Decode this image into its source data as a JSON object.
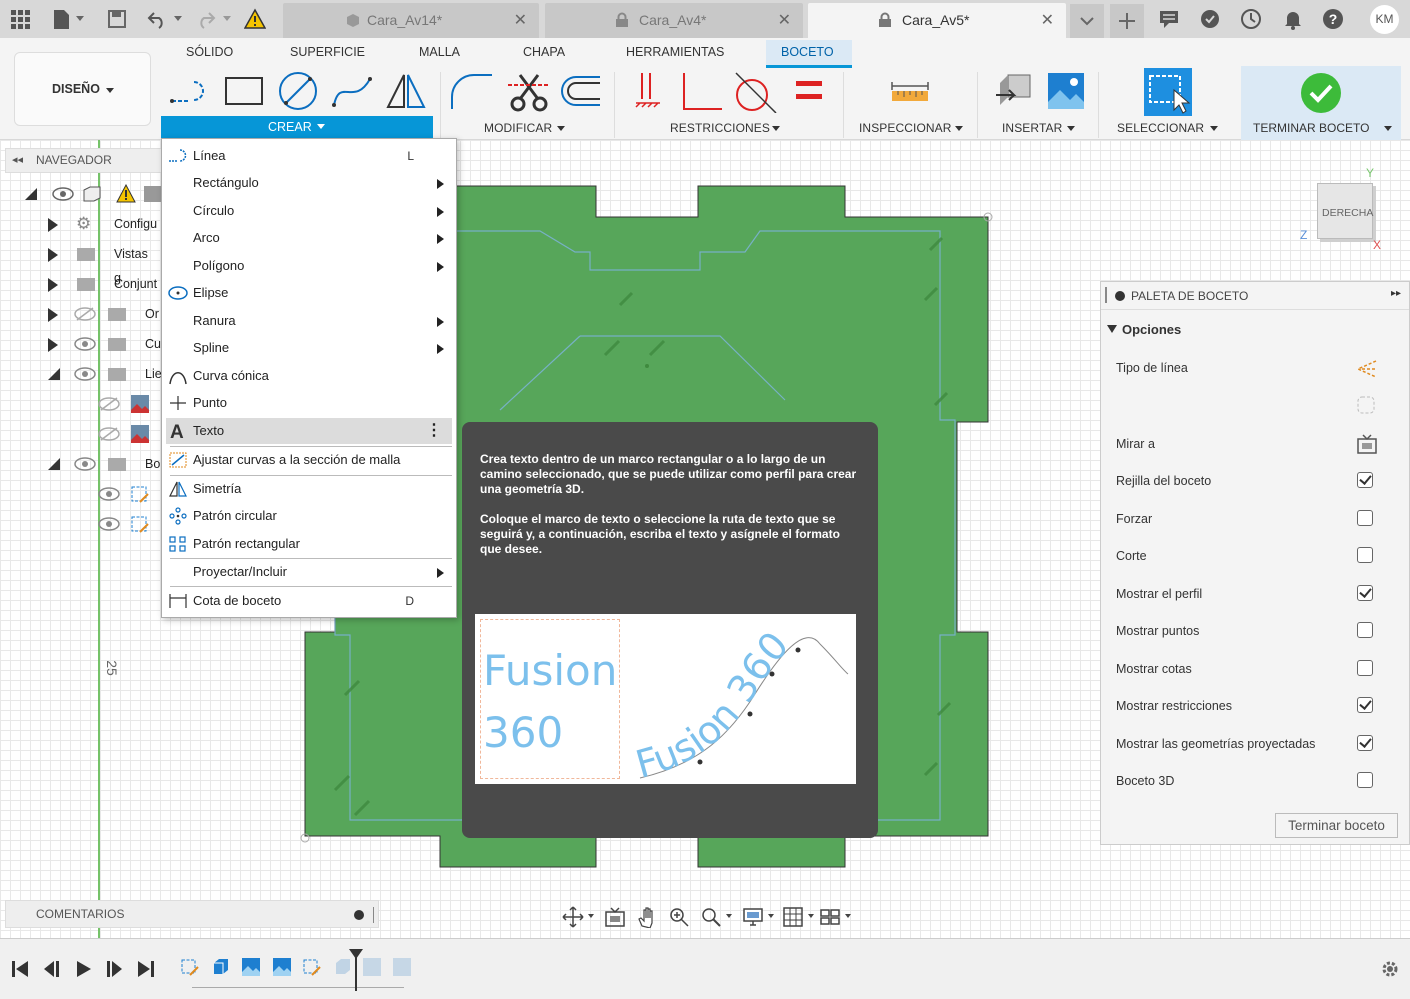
{
  "tabs": [
    {
      "label": "Cara_Av14*",
      "locked": false
    },
    {
      "label": "Cara_Av4*",
      "locked": true
    },
    {
      "label": "Cara_Av5*",
      "locked": true,
      "active": true
    }
  ],
  "user_initials": "KM",
  "ribbon_tabs": [
    "SÓLIDO",
    "SUPERFICIE",
    "MALLA",
    "CHAPA",
    "HERRAMIENTAS",
    "BOCETO"
  ],
  "active_ribbon_tab": "BOCETO",
  "workspace_label": "DISEÑO",
  "groups": {
    "crear": "CREAR",
    "modificar": "MODIFICAR",
    "restricciones": "RESTRICCIONES",
    "inspeccionar": "INSPECCIONAR",
    "insertar": "INSERTAR",
    "seleccionar": "SELECCIONAR",
    "terminar": "TERMINAR BOCETO"
  },
  "navigator": {
    "title": "NAVEGADOR",
    "rows": [
      "Configu",
      "Vistas g",
      "Conjunt",
      "Or",
      "Cu",
      "Lie",
      "Bo"
    ]
  },
  "menu": {
    "items": [
      {
        "label": "Línea",
        "shortcut": "L"
      },
      {
        "label": "Rectángulo"
      },
      {
        "label": "Círculo"
      },
      {
        "label": "Arco"
      },
      {
        "label": "Polígono"
      },
      {
        "label": "Elipse"
      },
      {
        "label": "Ranura"
      },
      {
        "label": "Spline"
      },
      {
        "label": "Curva cónica"
      },
      {
        "label": "Punto"
      },
      {
        "label": "Texto"
      },
      {
        "label": "Ajustar curvas a la sección de malla"
      },
      {
        "label": "Simetría"
      },
      {
        "label": "Patrón circular"
      },
      {
        "label": "Patrón rectangular"
      },
      {
        "label": "Proyectar/Incluir"
      },
      {
        "label": "Cota de boceto",
        "shortcut": "D"
      }
    ]
  },
  "tooltip": {
    "p1": "Crea texto dentro de un marco rectangular o a lo largo de un camino seleccionado, que se puede utilizar como perfil para crear una geometría 3D.",
    "p2": "Coloque el marco de texto o seleccione la ruta de texto que se seguirá y, a continuación, escriba el texto y asígnele el formato que desee.",
    "sample_line1": "Fusion",
    "sample_line2": "360",
    "sample_path_text": "Fusion 360"
  },
  "viewcube_label": "DERECHA",
  "axis_labels": {
    "y": "Y",
    "z": "Z",
    "x": "X"
  },
  "ruler_value": "25",
  "palette": {
    "title": "PALETA DE BOCETO",
    "section": "Opciones",
    "rows": [
      {
        "label": "Tipo de línea",
        "control": "icon"
      },
      {
        "label": "Mirar a",
        "control": "icon"
      },
      {
        "label": "Rejilla del boceto",
        "checked": true
      },
      {
        "label": "Forzar",
        "checked": false
      },
      {
        "label": "Corte",
        "checked": false
      },
      {
        "label": "Mostrar el perfil",
        "checked": true
      },
      {
        "label": "Mostrar puntos",
        "checked": false
      },
      {
        "label": "Mostrar cotas",
        "checked": false
      },
      {
        "label": "Mostrar restricciones",
        "checked": true
      },
      {
        "label": "Mostrar las geometrías proyectadas",
        "checked": true
      },
      {
        "label": "Boceto 3D",
        "checked": false
      }
    ],
    "finish_button": "Terminar boceto"
  },
  "comments_label": "COMENTARIOS",
  "colors": {
    "accent": "#0696d7",
    "sketch_green": "#57a65a",
    "tooltip_bg": "#4a4a4a"
  }
}
